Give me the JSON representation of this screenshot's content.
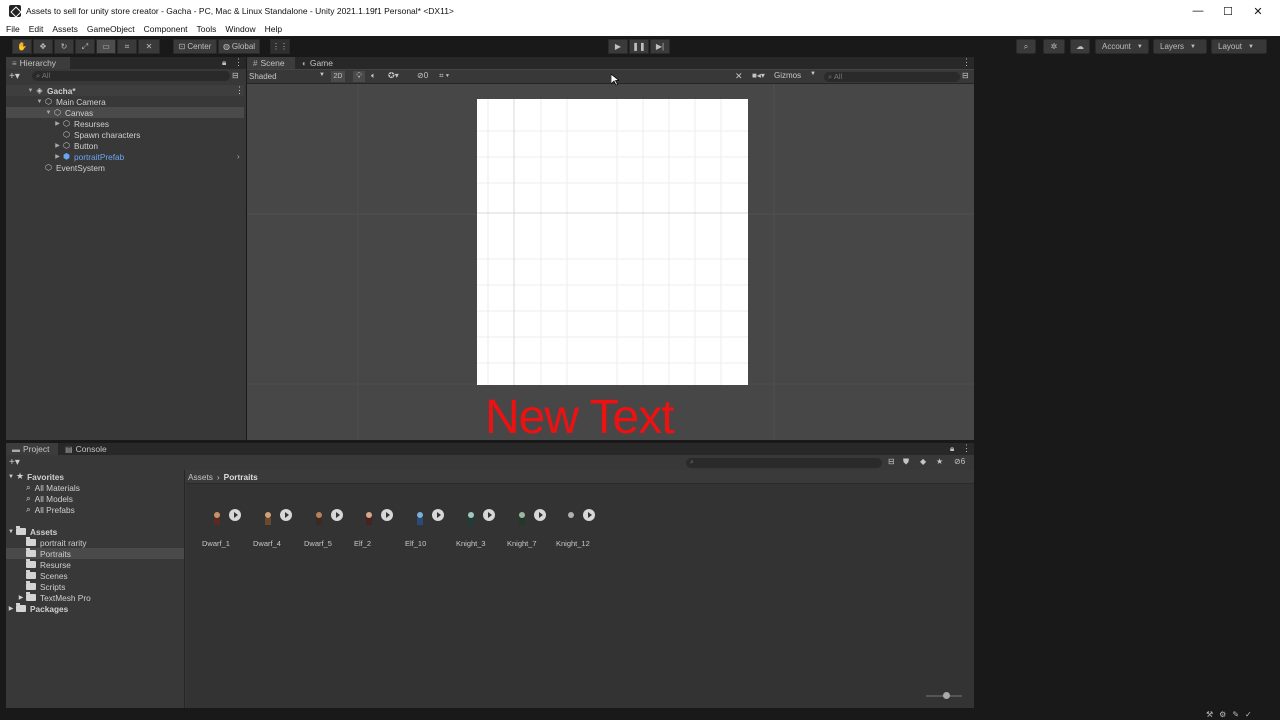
{
  "window": {
    "title": "Assets to sell for unity store creator - Gacha - PC, Mac & Linux Standalone - Unity 2021.1.19f1 Personal* <DX11>",
    "minimize": "—",
    "maximize": "☐",
    "close": "✕"
  },
  "menu": [
    "File",
    "Edit",
    "Assets",
    "GameObject",
    "Component",
    "Tools",
    "Window",
    "Help"
  ],
  "toolbar": {
    "pivot": "Center",
    "space": "Global",
    "account": "Account",
    "layers": "Layers",
    "layout": "Layout"
  },
  "hierarchy": {
    "tab": "Hierarchy",
    "search_placeholder": "All",
    "items": [
      {
        "label": "Gacha*"
      },
      {
        "label": "Main Camera"
      },
      {
        "label": "Canvas"
      },
      {
        "label": "Resurses"
      },
      {
        "label": "Spawn characters"
      },
      {
        "label": "Button"
      },
      {
        "label": "portraitPrefab"
      },
      {
        "label": "EventSystem"
      }
    ]
  },
  "scene": {
    "tabs": [
      "Scene",
      "Game"
    ],
    "shading": "Shaded",
    "mode2d": "2D",
    "hidden_count": "0",
    "gizmos": "Gizmos",
    "search_placeholder": "All",
    "canvas_text": "New Text"
  },
  "project": {
    "tabs": [
      "Project",
      "Console"
    ],
    "hidden_count": "6",
    "breadcrumb": [
      "Assets",
      "Portraits"
    ],
    "favorites_label": "Favorites",
    "favorites": [
      "All Materials",
      "All Models",
      "All Prefabs"
    ],
    "assets_label": "Assets",
    "folders": [
      "portrait rarity",
      "Portraits",
      "Resurse",
      "Scenes",
      "Scripts",
      "TextMesh Pro"
    ],
    "packages_label": "Packages",
    "files": [
      "Dwarf_1",
      "Dwarf_4",
      "Dwarf_5",
      "Elf_2",
      "Elf_10",
      "Knight_3",
      "Knight_7",
      "Knight_12"
    ]
  },
  "colors": {
    "prefab_blue": "#6aa5f2",
    "canvas_text_red": "#e11111"
  }
}
